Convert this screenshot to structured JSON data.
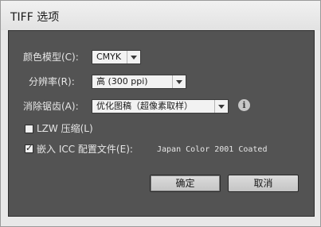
{
  "window": {
    "title": "TIFF 选项"
  },
  "color_model": {
    "label": "颜色模型(C):",
    "value": "CMYK"
  },
  "resolution": {
    "label": "分辨率(R):",
    "value": "高 (300 ppi)"
  },
  "anti_alias": {
    "label": "消除锯齿(A):",
    "value": "优化图稿（超像素取样）"
  },
  "lzw": {
    "label": "LZW 压缩(L)",
    "checked": false
  },
  "icc": {
    "label": "嵌入 ICC 配置文件(E):",
    "profile": "Japan Color 2001 Coated",
    "checked": true
  },
  "buttons": {
    "ok": "确定",
    "cancel": "取消"
  },
  "icons": {
    "info": "info-icon",
    "dropdown": "chevron-down-icon",
    "check": "checkmark-icon"
  },
  "colors": {
    "panel": "#535353",
    "titlebar": "#e8e8e8",
    "text": "#e6e6e6"
  }
}
